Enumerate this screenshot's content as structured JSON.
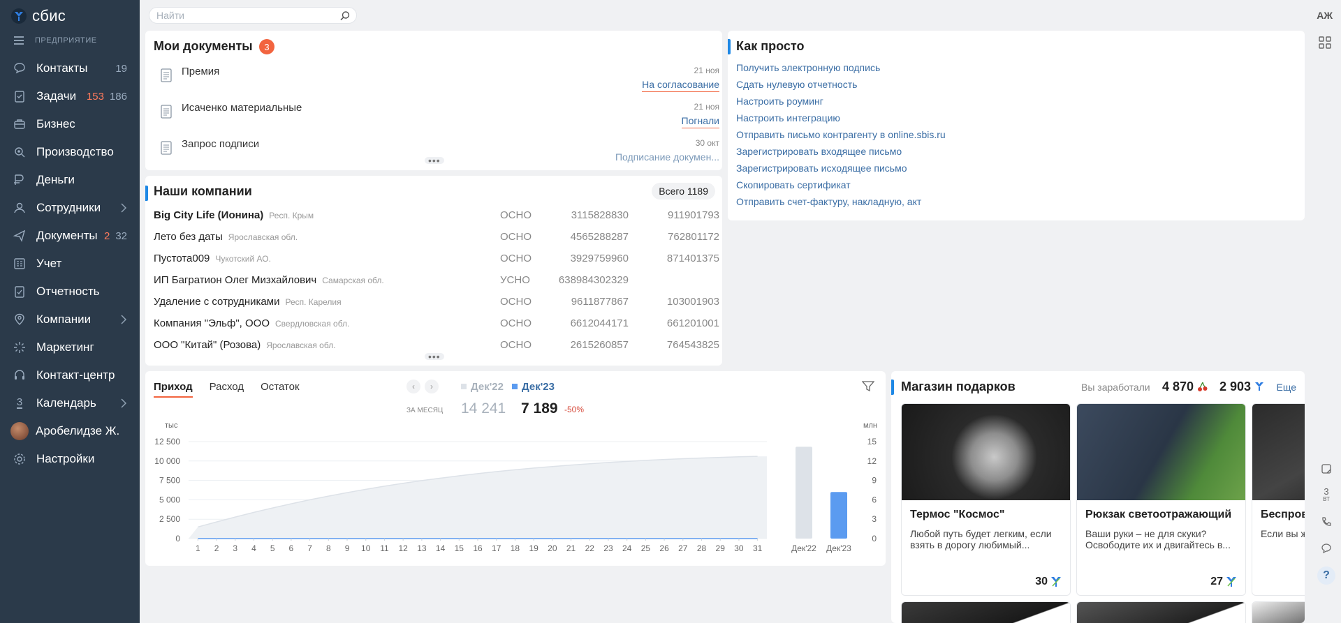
{
  "app": {
    "logo_text": "сбис",
    "company": "ПРЕДПРИЯТИЕ",
    "user_initials": "АЖ"
  },
  "search": {
    "placeholder": "Найти",
    "value": ""
  },
  "sidebar": {
    "items": [
      {
        "label": "Контакты",
        "icon": "chat-icon",
        "count1": "19",
        "count2": ""
      },
      {
        "label": "Задачи",
        "icon": "tasks-icon",
        "count1": "153",
        "count2": "186"
      },
      {
        "label": "Бизнес",
        "icon": "business-icon",
        "count1": "",
        "count2": ""
      },
      {
        "label": "Производство",
        "icon": "production-icon",
        "count1": "",
        "count2": ""
      },
      {
        "label": "Деньги",
        "icon": "money-icon",
        "count1": "",
        "count2": ""
      },
      {
        "label": "Сотрудники",
        "icon": "staff-icon",
        "count1": "",
        "count2": "",
        "chevron": true
      },
      {
        "label": "Документы",
        "icon": "documents-icon",
        "count1": "2",
        "count2": "32"
      },
      {
        "label": "Учет",
        "icon": "accounting-icon",
        "count1": "",
        "count2": ""
      },
      {
        "label": "Отчетность",
        "icon": "reporting-icon",
        "count1": "",
        "count2": ""
      },
      {
        "label": "Компании",
        "icon": "companies-icon",
        "count1": "",
        "count2": "",
        "chevron": true
      },
      {
        "label": "Маркетинг",
        "icon": "marketing-icon",
        "count1": "",
        "count2": ""
      },
      {
        "label": "Контакт-центр",
        "icon": "headset-icon",
        "count1": "",
        "count2": ""
      },
      {
        "label": "Календарь",
        "icon": "calendar-icon",
        "count1": "",
        "count2": "",
        "chevron": true,
        "icon_text": "3"
      },
      {
        "label": "Аробелидзе Ж.",
        "icon": "avatar",
        "count1": "",
        "count2": ""
      },
      {
        "label": "Настройки",
        "icon": "settings-icon",
        "count1": "",
        "count2": ""
      }
    ]
  },
  "docs": {
    "title": "Мои документы",
    "badge": "3",
    "rows": [
      {
        "name": "Премия",
        "date": "21 ноя",
        "status": "На согласование"
      },
      {
        "name": "Исаченко материальные",
        "date": "21 ноя",
        "status": "Погнали"
      },
      {
        "name": "Запрос подписи",
        "date": "30 окт",
        "status": "Подписание докумен..."
      }
    ]
  },
  "companies": {
    "title": "Наши компании",
    "total": "Всего 1189",
    "rows": [
      {
        "name": "Big City Life (Ионина)",
        "region": "Респ. Крым",
        "tax": "ОСНО",
        "inn": "3115828830",
        "kpp": "911901793",
        "bold": true
      },
      {
        "name": "Лето без даты",
        "region": "Ярославская обл.",
        "tax": "ОСНО",
        "inn": "4565288287",
        "kpp": "762801172"
      },
      {
        "name": "Пустота009",
        "region": "Чукотский АО.",
        "tax": "ОСНО",
        "inn": "3929759960",
        "kpp": "871401375"
      },
      {
        "name": "ИП Багратион Олег Мизхайлович",
        "region": "Самарская обл.",
        "tax": "УСНО",
        "inn": "638984302329",
        "kpp": ""
      },
      {
        "name": "Удаление с сотрудниками",
        "region": "Респ. Карелия",
        "tax": "ОСНО",
        "inn": "9611877867",
        "kpp": "103001903"
      },
      {
        "name": "Компания \"Эльф\", ООО",
        "region": "Свердловская обл.",
        "tax": "ОСНО",
        "inn": "6612044171",
        "kpp": "661201001"
      },
      {
        "name": "ООО \"Китай\" (Розова)",
        "region": "Ярославская обл.",
        "tax": "ОСНО",
        "inn": "2615260857",
        "kpp": "764543825"
      }
    ]
  },
  "howto": {
    "title": "Как просто",
    "links": [
      "Получить электронную подпись",
      "Сдать нулевую отчетность",
      "Настроить роуминг",
      "Настроить интеграцию",
      "Отправить письмо контрагенту в online.sbis.ru",
      "Зарегистрировать входящее письмо",
      "Зарегистрировать исходящее письмо",
      "Скопировать сертификат",
      "Отправить счет-фактуру, накладную, акт"
    ]
  },
  "finance": {
    "tabs": [
      "Приход",
      "Расход",
      "Остаток"
    ],
    "active_tab": "Приход",
    "legend_prev": "Дек'22",
    "legend_cur": "Дек'23",
    "period_label": "ЗА МЕСЯЦ",
    "value_prev": "14 241",
    "value_cur": "7 189",
    "delta": "-50%",
    "unit_left": "тыс",
    "unit_right": "млн"
  },
  "chart_data": [
    {
      "type": "area",
      "ylabel": "тыс",
      "ylim": [
        0,
        12500
      ],
      "y_ticks": [
        "12 500",
        "10 000",
        "7 500",
        "5 000",
        "2 500",
        "0"
      ],
      "x": [
        1,
        2,
        3,
        4,
        5,
        6,
        7,
        8,
        9,
        10,
        11,
        12,
        13,
        14,
        15,
        16,
        17,
        18,
        19,
        20,
        21,
        22,
        23,
        24,
        25,
        26,
        27,
        28,
        29,
        30,
        31
      ],
      "series": [
        {
          "name": "Дек'22",
          "values": [
            1500,
            2150,
            2780,
            3380,
            3950,
            4490,
            5000,
            5480,
            5930,
            6350,
            6750,
            7120,
            7470,
            7790,
            8090,
            8370,
            8630,
            8870,
            9090,
            9290,
            9480,
            9650,
            9810,
            9950,
            10080,
            10200,
            10300,
            10390,
            10470,
            10540,
            10600
          ]
        },
        {
          "name": "Дек'23",
          "values": [
            0,
            0,
            0,
            0,
            0,
            0,
            0,
            0,
            0,
            0,
            0,
            0,
            0,
            0,
            0,
            0,
            0,
            0,
            0,
            0,
            0,
            0,
            0,
            0,
            0,
            0,
            0,
            0,
            0,
            0,
            0
          ]
        }
      ],
      "grid": true
    },
    {
      "type": "bar",
      "ylabel": "млн",
      "ylim": [
        0,
        15
      ],
      "y_ticks": [
        "15",
        "12",
        "9",
        "6",
        "3",
        "0"
      ],
      "categories": [
        "Дек'22",
        "Дек'23"
      ],
      "values": [
        14.2,
        7.2
      ],
      "colors": [
        "#dde2e8",
        "#5b9bf0"
      ]
    }
  ],
  "shop": {
    "title": "Магазин подарков",
    "earned_label": "Вы заработали",
    "earned1": "4 870",
    "earned2": "2 903",
    "more": "Еще",
    "products": [
      {
        "title": "Термос \"Космос\"",
        "desc": "Любой путь будет легким, если взять в дорогу любимый...",
        "price": "30"
      },
      {
        "title": "Рюкзак светоотражающий",
        "desc": "Ваши руки – не для скуки? Освободите их и двигайтесь в...",
        "price": "27"
      },
      {
        "title": "Беспров Сбис",
        "desc": "Если вы ж «успеть в",
        "price": ""
      }
    ]
  },
  "rail": {
    "calendar_day": "3",
    "calendar_weekday": "ВТ",
    "help": "?"
  },
  "colors": {
    "accent": "#f2643f",
    "brand": "#1e88e5",
    "sidebar": "#2b3a4a",
    "link": "#3b6ea5"
  }
}
